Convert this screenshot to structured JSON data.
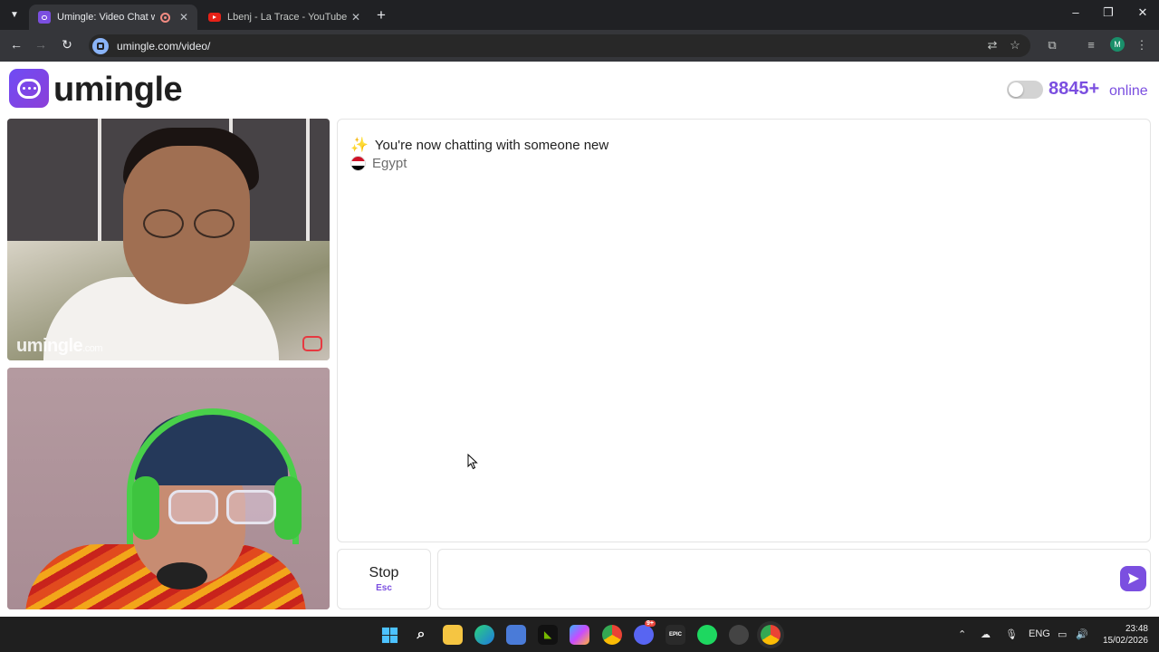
{
  "browser": {
    "tabs": [
      {
        "label": "Umingle: Video Chat with Str",
        "active": true
      },
      {
        "label": "Lbenj - La Trace - YouTube",
        "active": false
      }
    ],
    "url": "umingle.com/video/",
    "profile_initial": "M"
  },
  "header": {
    "brand": "umingle",
    "online_count": "8845+",
    "online_label": "online"
  },
  "videos": {
    "watermark_main": "umingle",
    "watermark_suffix": ".com"
  },
  "chat": {
    "system_message": "You're now chatting with someone new",
    "country": "Egypt",
    "flag_colors": [
      "#ce1126",
      "#ffffff",
      "#000000"
    ]
  },
  "controls": {
    "stop_label": "Stop",
    "stop_shortcut": "Esc",
    "message_placeholder": ""
  },
  "taskbar": {
    "language": "ENG",
    "time": "23:48",
    "date": "15/02/2026",
    "discord_badge": "9+",
    "epic_label": "EPIC"
  },
  "colors": {
    "accent": "#7b4fe0",
    "brand_gradient_start": "#6f4cf5",
    "brand_gradient_end": "#8b3fd8"
  }
}
